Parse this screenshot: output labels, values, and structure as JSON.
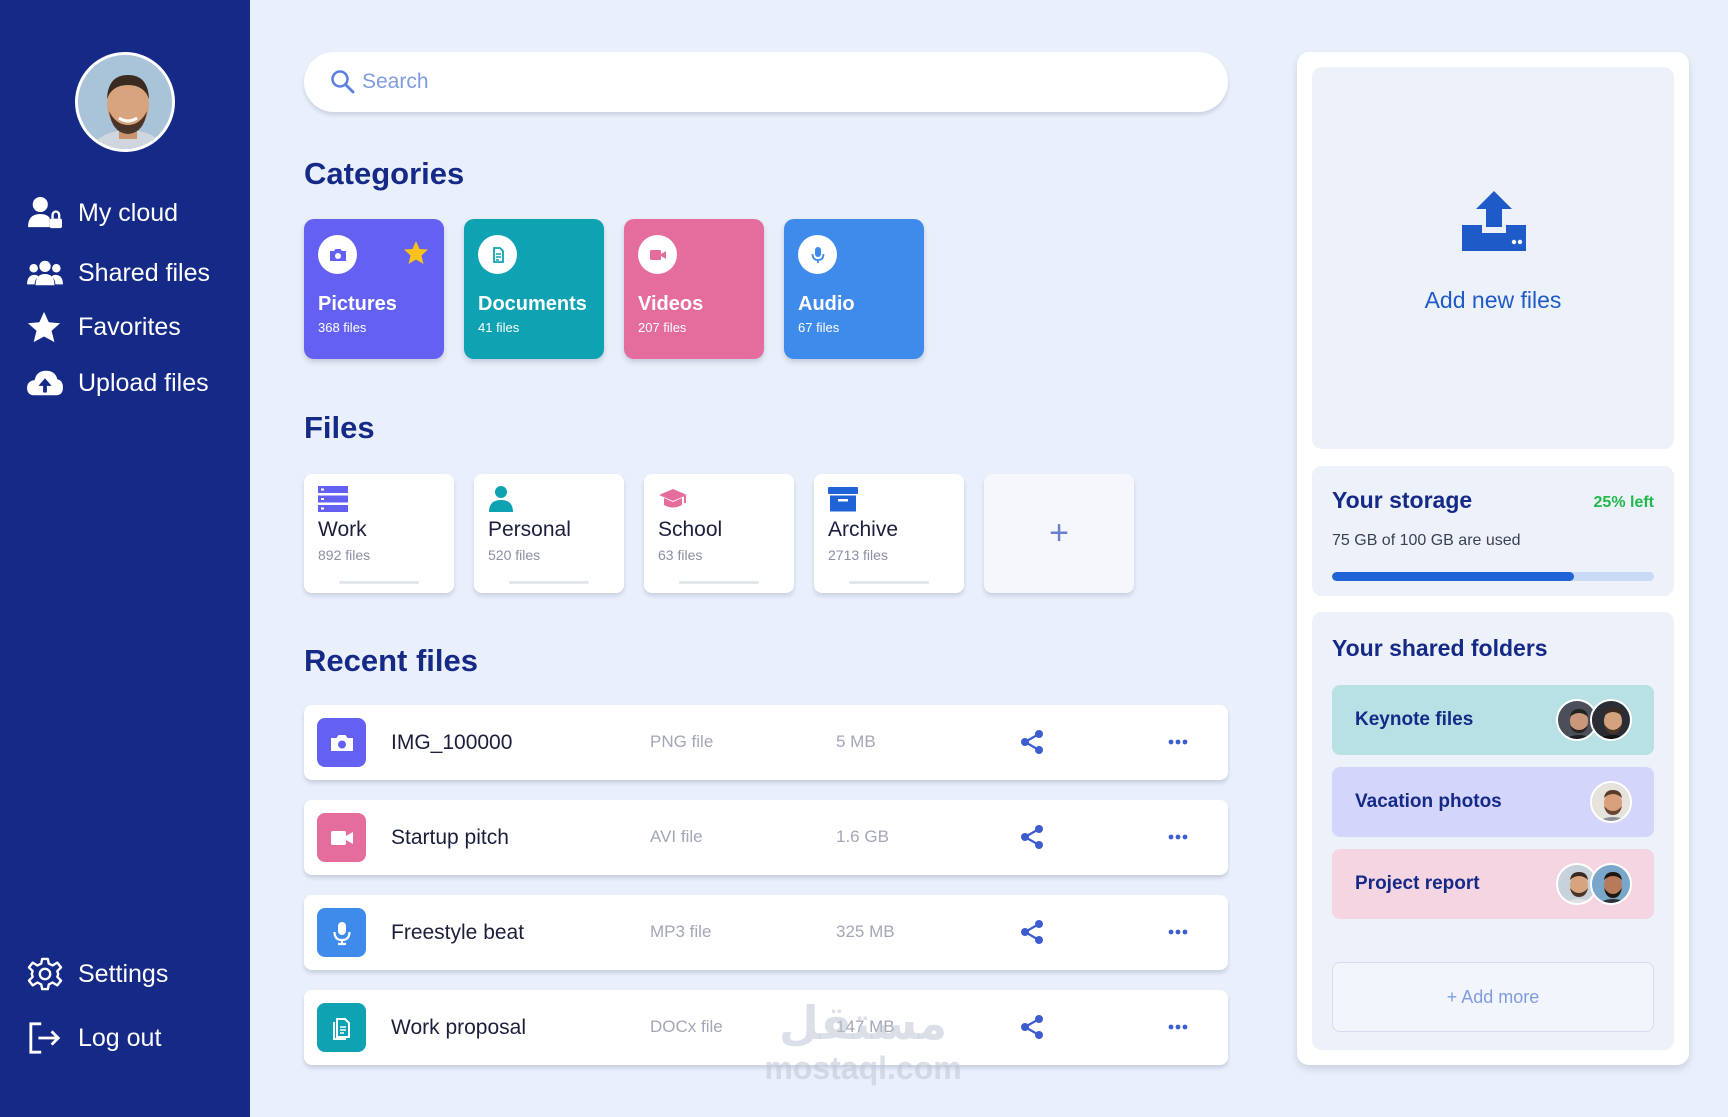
{
  "sidebar": {
    "nav": [
      {
        "label": "My cloud",
        "icon": "user-lock-icon"
      },
      {
        "label": "Shared files",
        "icon": "users-icon"
      },
      {
        "label": "Favorites",
        "icon": "star-icon"
      },
      {
        "label": "Upload files",
        "icon": "cloud-upload-icon"
      }
    ],
    "bottom": [
      {
        "label": "Settings",
        "icon": "gear-icon"
      },
      {
        "label": "Log out",
        "icon": "logout-icon"
      }
    ]
  },
  "search": {
    "placeholder": "Search"
  },
  "headings": {
    "categories": "Categories",
    "files": "Files",
    "recent": "Recent files"
  },
  "categories": [
    {
      "name": "Pictures",
      "count": "368 files",
      "icon": "camera-icon",
      "color": "#6461f2"
    },
    {
      "name": "Documents",
      "count": "41 files",
      "icon": "document-icon",
      "color": "#0ea2b3"
    },
    {
      "name": "Videos",
      "count": "207 files",
      "icon": "video-icon",
      "color": "#e56d9d"
    },
    {
      "name": "Audio",
      "count": "67 files",
      "icon": "microphone-icon",
      "color": "#3f8bec"
    }
  ],
  "folders": [
    {
      "name": "Work",
      "count": "892 files",
      "icon": "server-icon",
      "color": "#6461f2"
    },
    {
      "name": "Personal",
      "count": "520 files",
      "icon": "person-icon",
      "color": "#0ea2b3"
    },
    {
      "name": "School",
      "count": "63 files",
      "icon": "graduation-cap-icon",
      "color": "#e56d9d"
    },
    {
      "name": "Archive",
      "count": "2713 files",
      "icon": "archive-icon",
      "color": "#1f63d6"
    }
  ],
  "add_folder": "+",
  "recent": [
    {
      "name": "IMG_100000",
      "type": "PNG file",
      "size": "5 MB",
      "icon": "camera-icon",
      "color": "#6461f2"
    },
    {
      "name": "Startup pitch",
      "type": "AVI file",
      "size": "1.6 GB",
      "icon": "video-icon",
      "color": "#e56d9d"
    },
    {
      "name": "Freestyle beat",
      "type": "MP3 file",
      "size": "325 MB",
      "icon": "microphone-icon",
      "color": "#3f8bec"
    },
    {
      "name": "Work proposal",
      "type": "DOCx file",
      "size": "147 MB",
      "icon": "document-icon",
      "color": "#0ea2b3"
    }
  ],
  "upload": {
    "label": "Add new files"
  },
  "storage": {
    "title": "Your storage",
    "left": "25% left",
    "used": "75 GB of 100 GB are used",
    "used_fraction": 0.75
  },
  "shared": {
    "title": "Your shared folders",
    "folders": [
      {
        "name": "Keynote files",
        "color": "#b7e1e4"
      },
      {
        "name": "Vacation photos",
        "color": "#d3d5fb"
      },
      {
        "name": "Project report",
        "color": "#f6d5e2"
      }
    ],
    "add_more": "+ Add more"
  },
  "watermark": {
    "arabic": "مستقل",
    "latin": "mostaql.com"
  }
}
